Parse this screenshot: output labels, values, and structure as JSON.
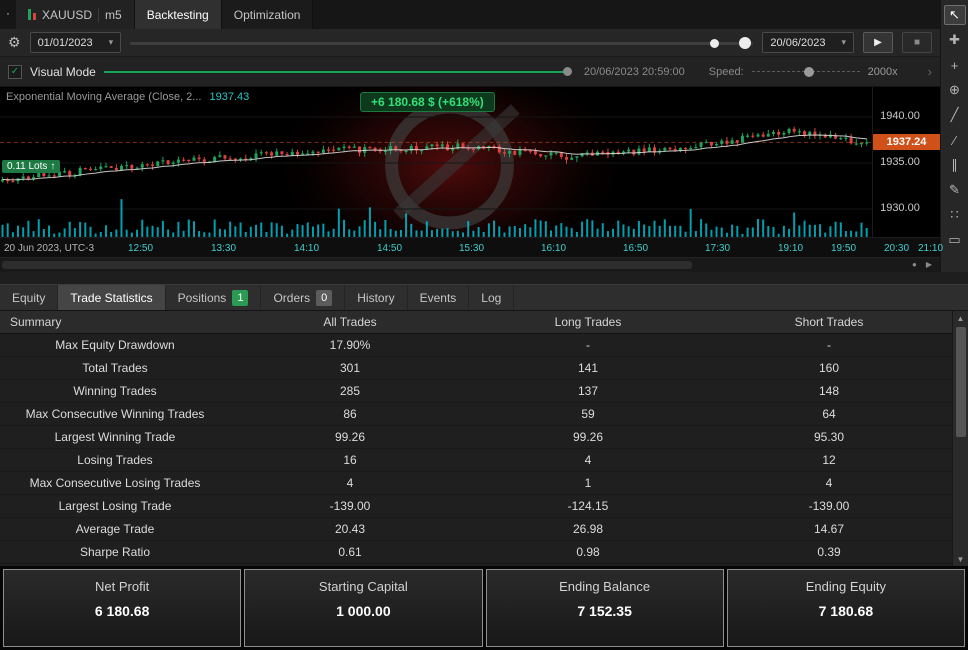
{
  "top_tabs": {
    "instrument": "XAUUSD",
    "timeframe": "m5",
    "backtesting": "Backtesting",
    "optimization": "Optimization"
  },
  "toolbar": {
    "start_date": "01/01/2023",
    "end_date": "20/06/2023"
  },
  "visual": {
    "label": "Visual Mode",
    "timestamp": "20/06/2023 20:59:00",
    "speed_label": "Speed:",
    "speed_value": "2000x"
  },
  "chart": {
    "indicator_label": "Exponential Moving Average (Close, 2...",
    "indicator_value": "1937.43",
    "profit_badge": "+6 180.68 $ (+618%)",
    "position_label": "0.11 Lots",
    "position_arrow": "↑",
    "current_price": "1937.24",
    "price_labels": [
      "1940.00",
      "1935.00",
      "1930.00"
    ],
    "time_labels": [
      "20 Jun 2023, UTC-3",
      "12:50",
      "13:30",
      "14:10",
      "14:50",
      "15:30",
      "16:10",
      "16:50",
      "17:30",
      "19:10",
      "19:50",
      "20:30",
      "21:10"
    ]
  },
  "side_tools": [
    {
      "name": "cursor-tool",
      "glyph": "↖",
      "active": true
    },
    {
      "name": "move-tool",
      "glyph": "✚"
    },
    {
      "name": "crosshair-tool",
      "glyph": "+"
    },
    {
      "name": "target-tool",
      "glyph": "⊕"
    },
    {
      "name": "trendline-tool",
      "glyph": "╱"
    },
    {
      "name": "ray-tool",
      "glyph": "∕"
    },
    {
      "name": "channel-tool",
      "glyph": "∥"
    },
    {
      "name": "brush-tool",
      "glyph": "✎"
    },
    {
      "name": "pattern-tool",
      "glyph": "∷"
    },
    {
      "name": "textbox-tool",
      "glyph": "▭"
    }
  ],
  "bottom_tabs": [
    {
      "label": "Equity"
    },
    {
      "label": "Trade Statistics",
      "active": true
    },
    {
      "label": "Positions",
      "badge": "1",
      "badge_style": "green"
    },
    {
      "label": "Orders",
      "badge": "0",
      "badge_style": "gray"
    },
    {
      "label": "History"
    },
    {
      "label": "Events"
    },
    {
      "label": "Log"
    }
  ],
  "table": {
    "headers": [
      "Summary",
      "All Trades",
      "Long Trades",
      "Short Trades"
    ],
    "rows": [
      [
        "Max Equity Drawdown",
        "17.90%",
        "-",
        "-"
      ],
      [
        "Total Trades",
        "301",
        "141",
        "160"
      ],
      [
        "Winning Trades",
        "285",
        "137",
        "148"
      ],
      [
        "Max Consecutive Winning Trades",
        "86",
        "59",
        "64"
      ],
      [
        "Largest Winning Trade",
        "99.26",
        "99.26",
        "95.30"
      ],
      [
        "Losing Trades",
        "16",
        "4",
        "12"
      ],
      [
        "Max Consecutive Losing Trades",
        "4",
        "1",
        "4"
      ],
      [
        "Largest Losing Trade",
        "-139.00",
        "-124.15",
        "-139.00"
      ],
      [
        "Average Trade",
        "20.43",
        "26.98",
        "14.67"
      ],
      [
        "Sharpe Ratio",
        "0.61",
        "0.98",
        "0.39"
      ]
    ]
  },
  "cards": [
    {
      "title": "Net Profit",
      "value": "6 180.68"
    },
    {
      "title": "Starting Capital",
      "value": "1 000.00"
    },
    {
      "title": "Ending Balance",
      "value": "7 152.35"
    },
    {
      "title": "Ending Equity",
      "value": "7 180.68"
    }
  ],
  "icons": {
    "menu": "▪",
    "gear": "⚙",
    "caret_down": "▾",
    "play": "▶",
    "stop": "■",
    "check": "✓",
    "chevron_right": "›",
    "scroll_dot": "●",
    "scroll_arrow": "▶",
    "up_arrow": "▲",
    "down_arrow": "▼"
  },
  "colors": {
    "accent_green": "#18a558",
    "candle_up": "#1fa35c",
    "candle_down": "#d9433b",
    "volume_cyan": "#00c8dc",
    "price_tag": "#cf5018",
    "axis_cyan": "#3ecfcf",
    "badge_green": "#2b9b53",
    "profit_text": "#35e07a"
  }
}
